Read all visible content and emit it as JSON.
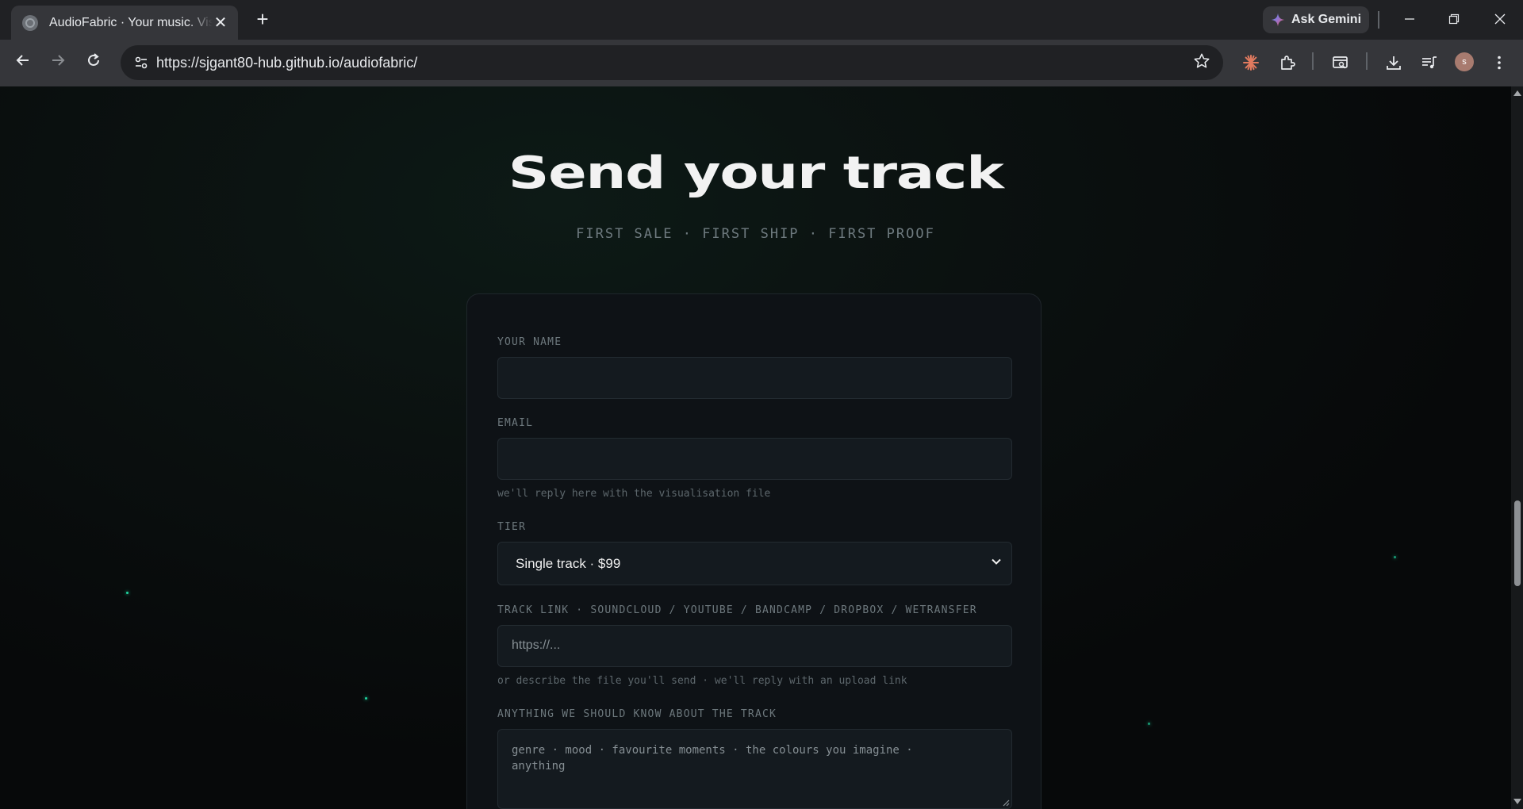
{
  "browser": {
    "tab_title": "AudioFabric · Your music. Visualised",
    "url": "https://sjgant80-hub.github.io/audiofabric/",
    "gemini_label": "Ask Gemini",
    "avatar_letter": "s"
  },
  "page": {
    "heading": "Send your track",
    "subheading": "FIRST SALE · FIRST SHIP · FIRST PROOF"
  },
  "form": {
    "name_label": "YOUR NAME",
    "name_value": "",
    "email_label": "EMAIL",
    "email_value": "",
    "email_hint": "we'll reply here with the visualisation file",
    "tier_label": "TIER",
    "tier_selected": "Single track · $99",
    "link_label": "TRACK LINK · SOUNDCLOUD / YOUTUBE / BANDCAMP / DROPBOX / WETRANSFER",
    "link_placeholder": "https://...",
    "link_hint": "or describe the file you'll send · we'll reply with an upload link",
    "notes_label": "ANYTHING WE SHOULD KNOW ABOUT THE TRACK",
    "notes_placeholder": "genre · mood · favourite moments · the colours you imagine · anything"
  },
  "colors": {
    "accent": "#1fd6a0",
    "background": "#0a0d0f",
    "card": "#0e1216"
  }
}
